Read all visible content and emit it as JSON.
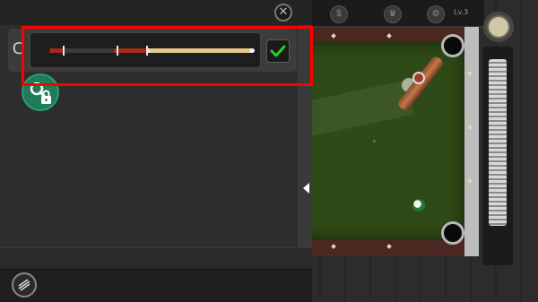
{
  "hud": {
    "level": "Lv.3",
    "buttons": [
      {
        "name": "hud-button-1",
        "icon": "shop-icon"
      },
      {
        "name": "hud-button-2",
        "icon": "trophy-icon"
      },
      {
        "name": "hud-button-3",
        "icon": "settings-icon"
      }
    ]
  },
  "panel": {
    "close_glyph": "✕",
    "refresh_glyph": "C",
    "selected_cue_checked": true,
    "accent_color": "#22aa22"
  },
  "scene": {
    "felt_color": "#2e4a16",
    "rail_color": "#4c2620",
    "power_level": 1.0
  }
}
